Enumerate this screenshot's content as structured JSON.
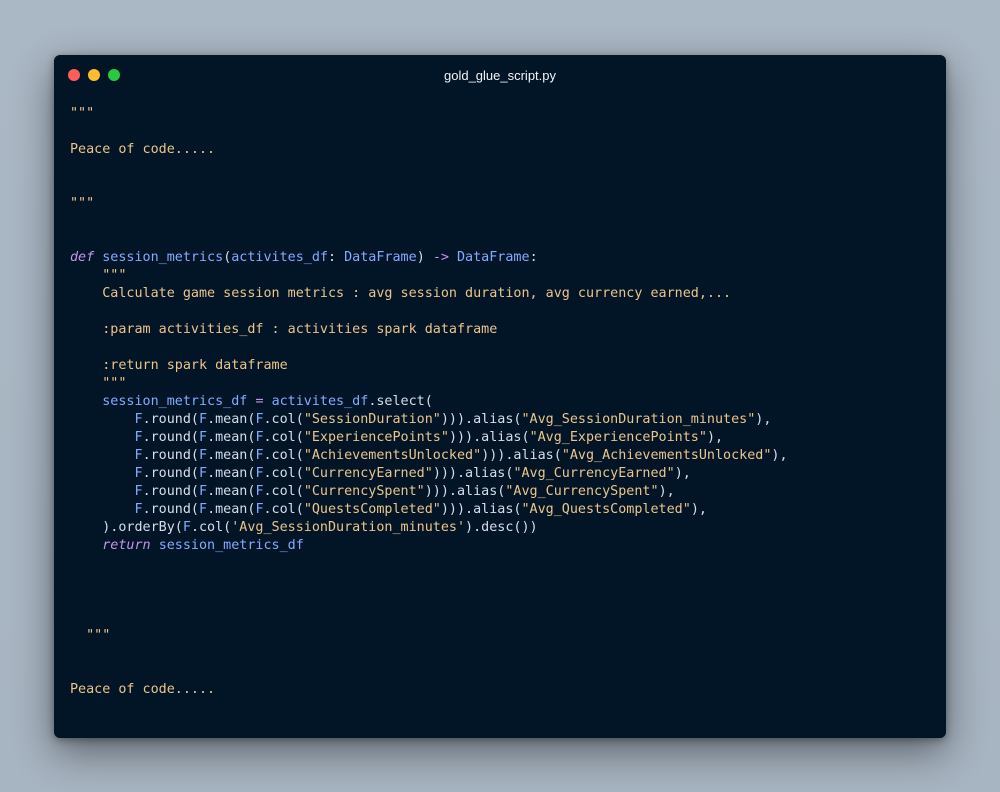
{
  "window": {
    "title": "gold_glue_script.py",
    "controls": {
      "close_color": "#ff5f57",
      "minimize_color": "#febc2e",
      "zoom_color": "#28c840"
    }
  },
  "theme": {
    "background": "#021526",
    "string": "#ecc48d",
    "keyword": "#c792ea",
    "function": "#82aaff",
    "text": "#d6deeb"
  },
  "code": {
    "lines": [
      [
        {
          "t": "\"\"\"",
          "c": "doc"
        }
      ],
      [],
      [
        {
          "t": "Peace of code.....",
          "c": "doc"
        }
      ],
      [],
      [],
      [
        {
          "t": "\"\"\"",
          "c": "doc"
        }
      ],
      [],
      [],
      [
        {
          "t": "def",
          "c": "kw"
        },
        {
          "t": " ",
          "c": "plain"
        },
        {
          "t": "session_metrics",
          "c": "fn"
        },
        {
          "t": "(",
          "c": "punc"
        },
        {
          "t": "activites_df",
          "c": "param"
        },
        {
          "t": ": ",
          "c": "punc"
        },
        {
          "t": "DataFrame",
          "c": "type"
        },
        {
          "t": ") ",
          "c": "punc"
        },
        {
          "t": "->",
          "c": "op"
        },
        {
          "t": " ",
          "c": "plain"
        },
        {
          "t": "DataFrame",
          "c": "type"
        },
        {
          "t": ":",
          "c": "punc"
        }
      ],
      [
        {
          "t": "    \"\"\"",
          "c": "doc"
        }
      ],
      [
        {
          "t": "    Calculate game session metrics : avg session duration, avg currency earned,...",
          "c": "doc"
        }
      ],
      [],
      [
        {
          "t": "    :param activities_df : activities spark dataframe",
          "c": "doc"
        }
      ],
      [],
      [
        {
          "t": "    :return spark dataframe",
          "c": "doc"
        }
      ],
      [
        {
          "t": "    \"\"\"",
          "c": "doc"
        }
      ],
      [
        {
          "t": "    ",
          "c": "plain"
        },
        {
          "t": "session_metrics_df",
          "c": "var"
        },
        {
          "t": " ",
          "c": "plain"
        },
        {
          "t": "=",
          "c": "op"
        },
        {
          "t": " ",
          "c": "plain"
        },
        {
          "t": "activites_df",
          "c": "var"
        },
        {
          "t": ".select(",
          "c": "plain"
        }
      ],
      [
        {
          "t": "        ",
          "c": "plain"
        },
        {
          "t": "F",
          "c": "F"
        },
        {
          "t": ".round(",
          "c": "plain"
        },
        {
          "t": "F",
          "c": "F"
        },
        {
          "t": ".mean(",
          "c": "plain"
        },
        {
          "t": "F",
          "c": "F"
        },
        {
          "t": ".col(",
          "c": "plain"
        },
        {
          "t": "\"SessionDuration\"",
          "c": "str"
        },
        {
          "t": "))).alias(",
          "c": "plain"
        },
        {
          "t": "\"Avg_SessionDuration_minutes\"",
          "c": "str"
        },
        {
          "t": "),",
          "c": "plain"
        }
      ],
      [
        {
          "t": "        ",
          "c": "plain"
        },
        {
          "t": "F",
          "c": "F"
        },
        {
          "t": ".round(",
          "c": "plain"
        },
        {
          "t": "F",
          "c": "F"
        },
        {
          "t": ".mean(",
          "c": "plain"
        },
        {
          "t": "F",
          "c": "F"
        },
        {
          "t": ".col(",
          "c": "plain"
        },
        {
          "t": "\"ExperiencePoints\"",
          "c": "str"
        },
        {
          "t": "))).alias(",
          "c": "plain"
        },
        {
          "t": "\"Avg_ExperiencePoints\"",
          "c": "str"
        },
        {
          "t": "),",
          "c": "plain"
        }
      ],
      [
        {
          "t": "        ",
          "c": "plain"
        },
        {
          "t": "F",
          "c": "F"
        },
        {
          "t": ".round(",
          "c": "plain"
        },
        {
          "t": "F",
          "c": "F"
        },
        {
          "t": ".mean(",
          "c": "plain"
        },
        {
          "t": "F",
          "c": "F"
        },
        {
          "t": ".col(",
          "c": "plain"
        },
        {
          "t": "\"AchievementsUnlocked\"",
          "c": "str"
        },
        {
          "t": "))).alias(",
          "c": "plain"
        },
        {
          "t": "\"Avg_AchievementsUnlocked\"",
          "c": "str"
        },
        {
          "t": "),",
          "c": "plain"
        }
      ],
      [
        {
          "t": "        ",
          "c": "plain"
        },
        {
          "t": "F",
          "c": "F"
        },
        {
          "t": ".round(",
          "c": "plain"
        },
        {
          "t": "F",
          "c": "F"
        },
        {
          "t": ".mean(",
          "c": "plain"
        },
        {
          "t": "F",
          "c": "F"
        },
        {
          "t": ".col(",
          "c": "plain"
        },
        {
          "t": "\"CurrencyEarned\"",
          "c": "str"
        },
        {
          "t": "))).alias(",
          "c": "plain"
        },
        {
          "t": "\"Avg_CurrencyEarned\"",
          "c": "str"
        },
        {
          "t": "),",
          "c": "plain"
        }
      ],
      [
        {
          "t": "        ",
          "c": "plain"
        },
        {
          "t": "F",
          "c": "F"
        },
        {
          "t": ".round(",
          "c": "plain"
        },
        {
          "t": "F",
          "c": "F"
        },
        {
          "t": ".mean(",
          "c": "plain"
        },
        {
          "t": "F",
          "c": "F"
        },
        {
          "t": ".col(",
          "c": "plain"
        },
        {
          "t": "\"CurrencySpent\"",
          "c": "str"
        },
        {
          "t": "))).alias(",
          "c": "plain"
        },
        {
          "t": "\"Avg_CurrencySpent\"",
          "c": "str"
        },
        {
          "t": "),",
          "c": "plain"
        }
      ],
      [
        {
          "t": "        ",
          "c": "plain"
        },
        {
          "t": "F",
          "c": "F"
        },
        {
          "t": ".round(",
          "c": "plain"
        },
        {
          "t": "F",
          "c": "F"
        },
        {
          "t": ".mean(",
          "c": "plain"
        },
        {
          "t": "F",
          "c": "F"
        },
        {
          "t": ".col(",
          "c": "plain"
        },
        {
          "t": "\"QuestsCompleted\"",
          "c": "str"
        },
        {
          "t": "))).alias(",
          "c": "plain"
        },
        {
          "t": "\"Avg_QuestsCompleted\"",
          "c": "str"
        },
        {
          "t": "),",
          "c": "plain"
        }
      ],
      [
        {
          "t": "    ).orderBy(",
          "c": "plain"
        },
        {
          "t": "F",
          "c": "F"
        },
        {
          "t": ".col(",
          "c": "plain"
        },
        {
          "t": "'Avg_SessionDuration_minutes'",
          "c": "str"
        },
        {
          "t": ").desc())",
          "c": "plain"
        }
      ],
      [
        {
          "t": "    ",
          "c": "plain"
        },
        {
          "t": "return",
          "c": "kw"
        },
        {
          "t": " ",
          "c": "plain"
        },
        {
          "t": "session_metrics_df",
          "c": "var"
        }
      ],
      [],
      [],
      [],
      [],
      [
        {
          "t": "  \"\"\"",
          "c": "doc"
        }
      ],
      [],
      [],
      [
        {
          "t": "Peace of code.....",
          "c": "doc"
        }
      ],
      [],
      [],
      [],
      [
        {
          "t": "\"\"\"",
          "c": "doc"
        }
      ]
    ]
  }
}
